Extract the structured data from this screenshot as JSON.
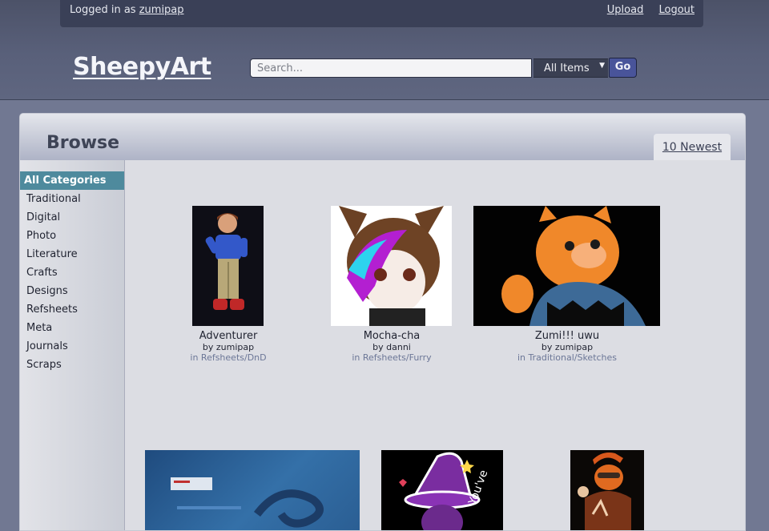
{
  "topbar": {
    "logged_in_prefix": "Logged in as",
    "username": "zumipap",
    "upload": "Upload",
    "logout": "Logout"
  },
  "site": {
    "logo": "SheepyArt"
  },
  "search": {
    "placeholder": "Search...",
    "scope": "All Items",
    "go": "Go"
  },
  "panel": {
    "title": "Browse",
    "tab": "10 Newest"
  },
  "sidebar": {
    "items": [
      {
        "label": "All Categories"
      },
      {
        "label": "Traditional"
      },
      {
        "label": "Digital"
      },
      {
        "label": "Photo"
      },
      {
        "label": "Literature"
      },
      {
        "label": "Crafts"
      },
      {
        "label": "Designs"
      },
      {
        "label": "Refsheets"
      },
      {
        "label": "Meta"
      },
      {
        "label": "Journals"
      },
      {
        "label": "Scraps"
      }
    ]
  },
  "gallery": {
    "items": [
      {
        "title": "Adventurer",
        "by": "by zumipap",
        "in": "in Refsheets/DnD"
      },
      {
        "title": "Mocha-cha",
        "by": "by danni",
        "in": "in Refsheets/Furry"
      },
      {
        "title": "Zumi!!! uwu",
        "by": "by zumipap",
        "in": "in Traditional/Sketches"
      }
    ]
  },
  "colors": {
    "accent": "#4e8a9d",
    "header": "#3a4057",
    "go_button": "#49549a"
  }
}
